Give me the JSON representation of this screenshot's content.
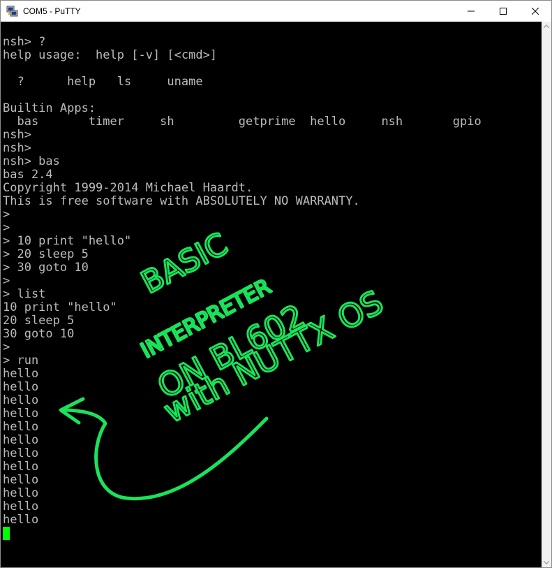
{
  "window": {
    "title": "COM5 - PuTTY",
    "app_icon": "putty-icon",
    "controls": {
      "minimize_icon": "minimize-icon",
      "maximize_icon": "maximize-icon",
      "close_icon": "close-icon"
    }
  },
  "terminal": {
    "background": "#000000",
    "foreground": "#bbbbbb",
    "cursor_color": "#00ff00",
    "lines": [
      "nsh> ?",
      "help usage:  help [-v] [<cmd>]",
      "",
      "  ?      help   ls     uname",
      "",
      "Builtin Apps:",
      "  bas       timer     sh         getprime  hello     nsh       gpio",
      "nsh>",
      "nsh>",
      "nsh> bas",
      "bas 2.4",
      "Copyright 1999-2014 Michael Haardt.",
      "This is free software with ABSOLUTELY NO WARRANTY.",
      ">",
      ">",
      "> 10 print \"hello\"",
      "> 20 sleep 5",
      "> 30 goto 10",
      ">",
      "> list",
      "10 print \"hello\"",
      "20 sleep 5",
      "30 goto 10",
      ">",
      "> run",
      "hello",
      "hello",
      "hello",
      "hello",
      "hello",
      "hello",
      "hello",
      "hello",
      "hello",
      "hello",
      "hello",
      "hello"
    ]
  },
  "annotation": {
    "color": "#19e35a",
    "lines": [
      "BASIC",
      "INTERPRETER",
      "ON BL602",
      "with NUTTX OS"
    ],
    "arrow_icon": "curved-arrow-icon"
  },
  "scrollbar": {
    "up_icon": "scroll-up-icon",
    "down_icon": "scroll-down-icon"
  }
}
